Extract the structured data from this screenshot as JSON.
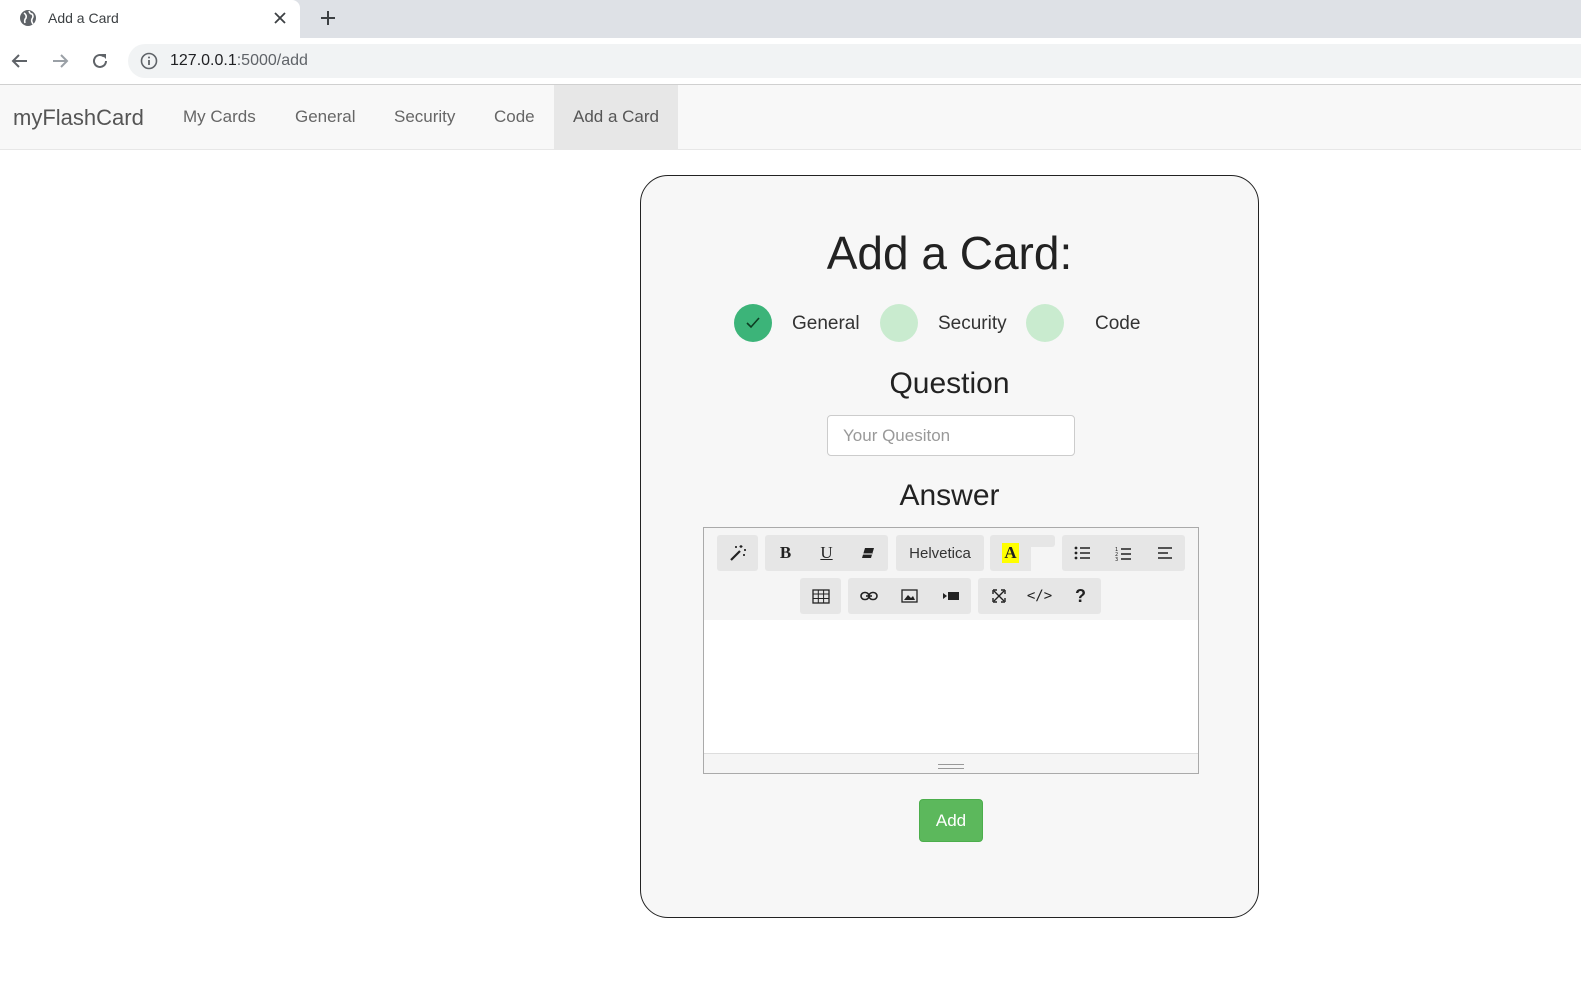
{
  "browser": {
    "tab_title": "Add a Card",
    "url_host": "127.0.0.1",
    "url_rest": ":5000/add"
  },
  "navbar": {
    "brand": "myFlashCard",
    "links": [
      {
        "label": "My Cards"
      },
      {
        "label": "General"
      },
      {
        "label": "Security"
      },
      {
        "label": "Code"
      },
      {
        "label": "Add a Card",
        "active": true
      }
    ]
  },
  "card": {
    "title": "Add a Card:",
    "steps": [
      {
        "label": "General",
        "state": "done"
      },
      {
        "label": "Security",
        "state": "pending"
      },
      {
        "label": "Code",
        "state": "pending"
      }
    ],
    "question_label": "Question",
    "question_placeholder": "Your Quesiton",
    "question_value": "",
    "answer_label": "Answer",
    "toolbar": {
      "font_name": "Helvetica",
      "icons": [
        "magic-icon",
        "bold-icon",
        "underline-icon",
        "eraser-icon",
        "font-name",
        "text-color-icon",
        "unordered-list-icon",
        "ordered-list-icon",
        "align-icon",
        "table-icon",
        "link-icon",
        "picture-icon",
        "video-icon",
        "fullscreen-icon",
        "code-view-icon",
        "help-icon"
      ]
    },
    "add_label": "Add"
  },
  "colors": {
    "step_done": "#3cb479",
    "step_pending": "#c9ebcf",
    "add_button": "#5cb85c"
  }
}
